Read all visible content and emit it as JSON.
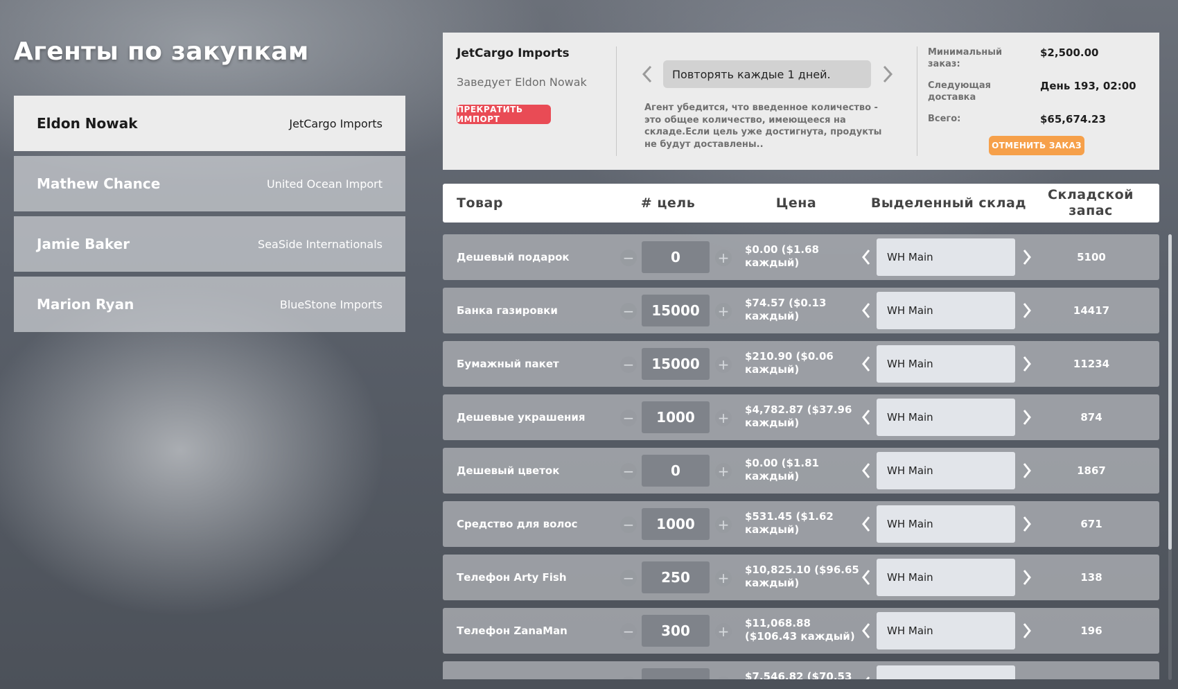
{
  "page_title": "Агенты по закупкам",
  "agents": [
    {
      "name": "Eldon Nowak",
      "company": "JetCargo Imports",
      "selected": true
    },
    {
      "name": "Mathew Chance",
      "company": "United Ocean Import",
      "selected": false
    },
    {
      "name": "Jamie Baker",
      "company": "SeaSide Internationals",
      "selected": false
    },
    {
      "name": "Marion Ryan",
      "company": "BlueStone Imports",
      "selected": false
    }
  ],
  "agent_info": {
    "company": "JetCargo Imports",
    "manager": "Заведует Eldon Nowak",
    "stop_button": "ПРЕКРАТИТЬ ИМПОРТ",
    "repeat_label": "Повторять каждые 1 дней.",
    "note": "Агент убедится, что введенное количество - это общее количество, имеющееся на складе.Если цель уже достигнута, продукты не будут доставлены..",
    "min_order_label": "Минимальный заказ:",
    "min_order_value": "$2,500.00",
    "next_delivery_label": "Следующая доставка",
    "next_delivery_value": "День 193, 02:00",
    "total_label": "Всего:",
    "total_value": "$65,674.23",
    "cancel_button": "ОТМЕНИТЬ ЗАКАЗ",
    "arrow_color": "#9a9a9a",
    "stop_color": "#e94b55",
    "cancel_color": "#f6a04a"
  },
  "table": {
    "headers": {
      "product": "Товар",
      "target": "# цель",
      "price": "Цена",
      "warehouse": "Выделенный склад",
      "stock": "Складской запас"
    },
    "rows": [
      {
        "product": "Дешевый подарок",
        "qty": "0",
        "price": "$0.00 ($1.68 каждый)",
        "warehouse": "WH Main",
        "stock": "5100"
      },
      {
        "product": "Банка газировки",
        "qty": "15000",
        "price": "$74.57 ($0.13 каждый)",
        "warehouse": "WH Main",
        "stock": "14417"
      },
      {
        "product": "Бумажный пакет",
        "qty": "15000",
        "price": "$210.90 ($0.06 каждый)",
        "warehouse": "WH Main",
        "stock": "11234"
      },
      {
        "product": "Дешевые украшения",
        "qty": "1000",
        "price": "$4,782.87 ($37.96 каждый)",
        "warehouse": "WH Main",
        "stock": "874"
      },
      {
        "product": "Дешевый цветок",
        "qty": "0",
        "price": "$0.00 ($1.81 каждый)",
        "warehouse": "WH Main",
        "stock": "1867"
      },
      {
        "product": "Средство для волос",
        "qty": "1000",
        "price": "$531.45 ($1.62 каждый)",
        "warehouse": "WH Main",
        "stock": "671"
      },
      {
        "product": "Телефон Arty Fish",
        "qty": "250",
        "price": "$10,825.10 ($96.65 каждый)",
        "warehouse": "WH Main",
        "stock": "138"
      },
      {
        "product": "Телефон ZanaMan",
        "qty": "300",
        "price": "$11,068.88 ($106.43 каждый)",
        "warehouse": "WH Main",
        "stock": "196"
      },
      {
        "product": "",
        "qty": "",
        "price": "$7,546.82 ($70.53",
        "warehouse": "",
        "stock": ""
      }
    ]
  },
  "icons": {
    "minus": "minus-icon",
    "plus": "plus-icon",
    "chevron_left": "chevron-left-icon",
    "chevron_right": "chevron-right-icon"
  },
  "scroll_position": 0.71
}
